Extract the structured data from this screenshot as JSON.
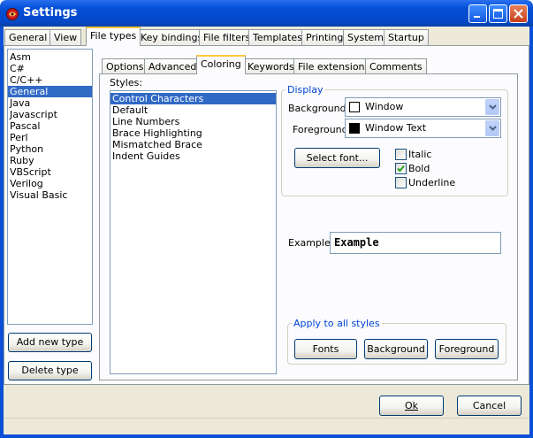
{
  "window": {
    "title": "Settings"
  },
  "outer_tabs": [
    "General",
    "View",
    "File types",
    "Key bindings",
    "File filters",
    "Templates",
    "Printing",
    "System",
    "Startup"
  ],
  "outer_active_tab": "File types",
  "file_types": [
    "Asm",
    "C#",
    "C/C++",
    "General",
    "Java",
    "Javascript",
    "Pascal",
    "Perl",
    "Python",
    "Ruby",
    "VBScript",
    "Verilog",
    "Visual Basic"
  ],
  "file_types_selected": "General",
  "file_type_buttons": {
    "add": "Add new type",
    "delete": "Delete type"
  },
  "inner_tabs": [
    "Options",
    "Advanced",
    "Coloring",
    "Keywords",
    "File extensions",
    "Comments"
  ],
  "inner_active_tab": "Coloring",
  "styles": {
    "label": "Styles:",
    "items": [
      "Control Characters",
      "Default",
      "Line Numbers",
      "Brace Highlighting",
      "Mismatched Brace",
      "Indent Guides"
    ],
    "selected": "Control Characters"
  },
  "display": {
    "group_title": "Display",
    "background_label": "Background:",
    "background_value": "Window",
    "background_swatch": "#ffffff",
    "foreground_label": "Foreground:",
    "foreground_value": "Window Text",
    "foreground_swatch": "#000000",
    "select_font_button": "Select font...",
    "italic_label": "Italic",
    "italic_checked": false,
    "bold_label": "Bold",
    "bold_checked": true,
    "underline_label": "Underline",
    "underline_checked": false
  },
  "example": {
    "label": "Example:",
    "text": "Example"
  },
  "apply_all": {
    "group_title": "Apply to all styles",
    "fonts_button": "Fonts",
    "background_button": "Background",
    "foreground_button": "Foreground"
  },
  "dialog_buttons": {
    "ok": "Ok",
    "cancel": "Cancel"
  },
  "colors": {
    "titlebar": "#0550d8",
    "selection": "#316ac5",
    "group_title": "#0046d5",
    "check_green": "#21a121"
  }
}
